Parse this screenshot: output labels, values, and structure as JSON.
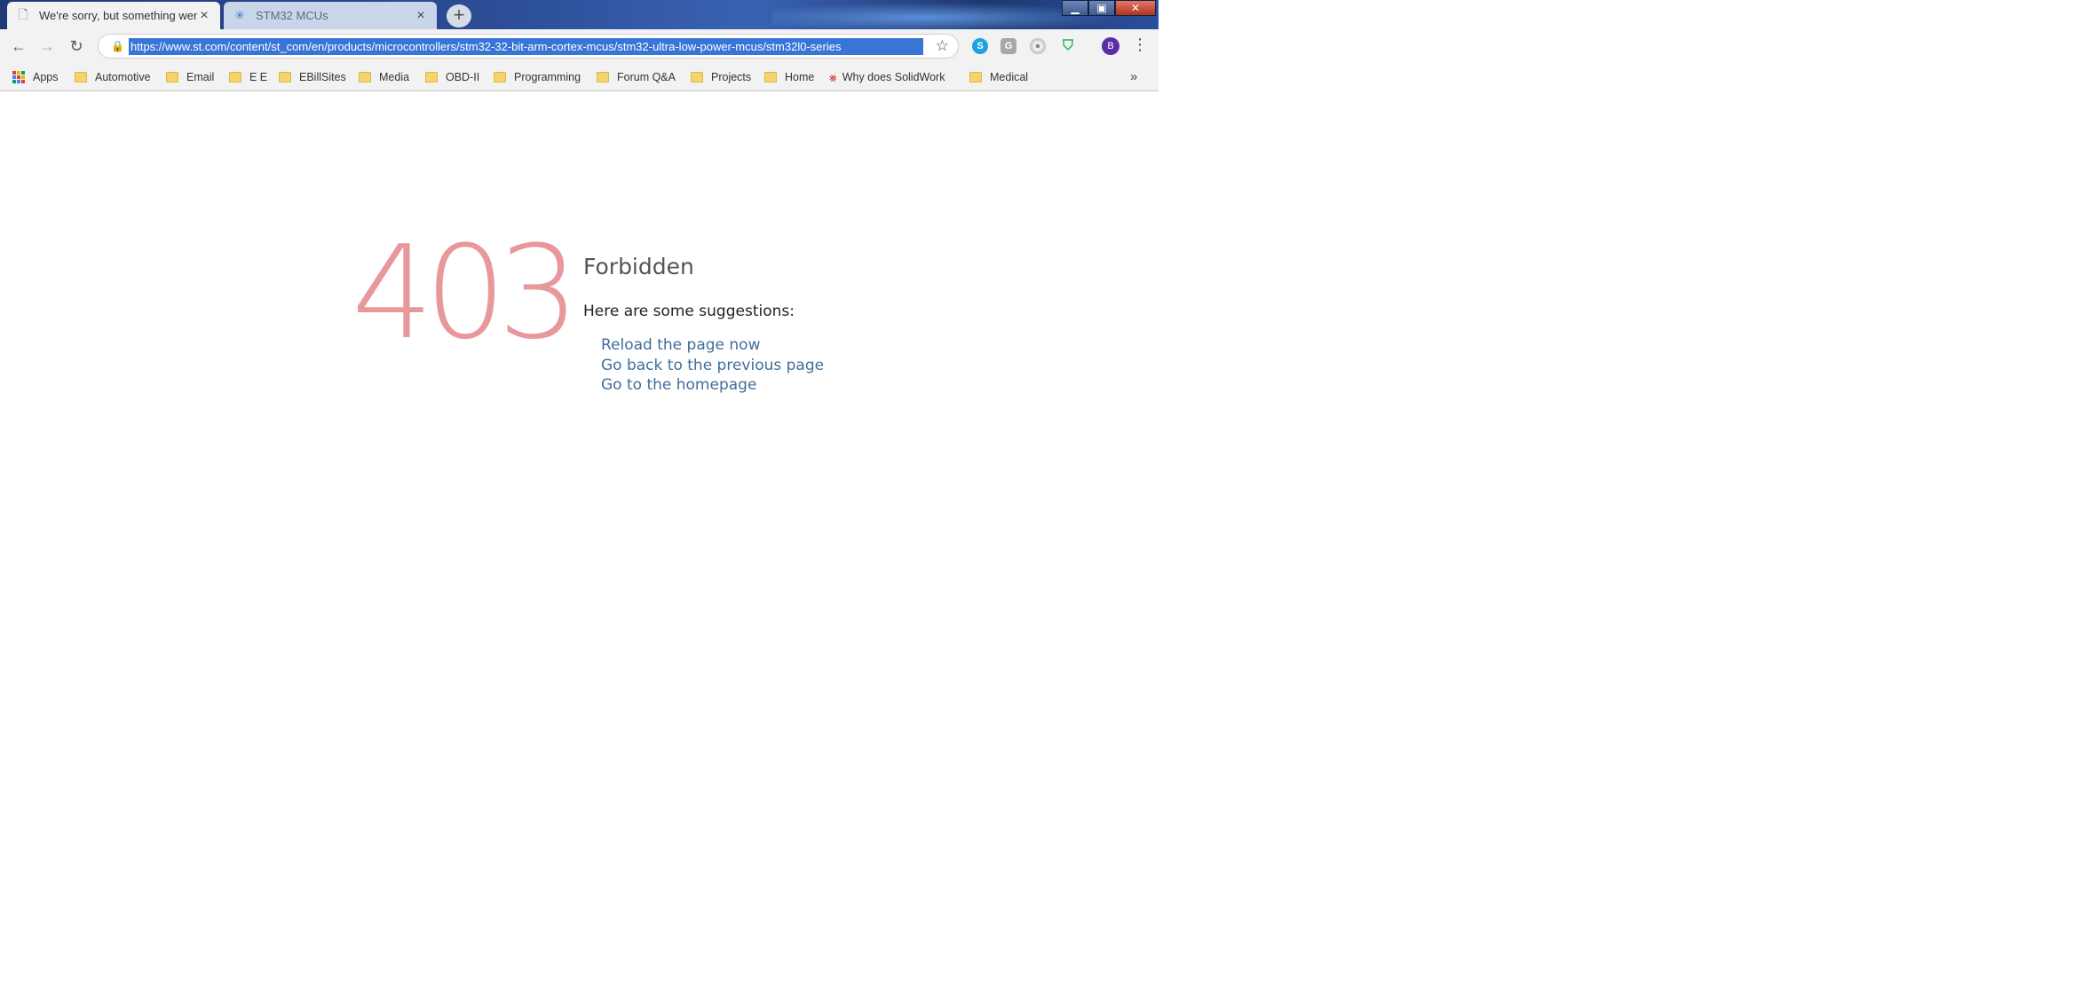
{
  "browser": {
    "tabs": [
      {
        "title": "We're sorry, but something went",
        "active": true,
        "favicon": "page-icon"
      },
      {
        "title": "STM32 MCUs",
        "active": false,
        "favicon": "st-logo-icon"
      }
    ],
    "new_tab_symbol": "+",
    "window_controls": {
      "minimize": "▁",
      "maximize": "▣",
      "close": "✕"
    },
    "url": "https://www.st.com/content/st_com/en/products/microcontrollers/stm32-32-bit-arm-cortex-mcus/stm32-ultra-low-power-mcus/stm32l0-series",
    "profile_initial": "B",
    "extensions": [
      "skype-icon",
      "gray-extension-icon",
      "circle-extension-icon",
      "shield-icon"
    ],
    "accent_color": "#3875d7"
  },
  "bookmarks": {
    "apps_label": "Apps",
    "items": [
      {
        "label": "Automotive"
      },
      {
        "label": "Email"
      },
      {
        "label": "E E"
      },
      {
        "label": "EBillSites"
      },
      {
        "label": "Media"
      },
      {
        "label": "OBD-II"
      },
      {
        "label": "Programming"
      },
      {
        "label": "Forum Q&A"
      },
      {
        "label": "Projects"
      },
      {
        "label": "Home"
      },
      {
        "label": "Why does SolidWork"
      },
      {
        "label": "Medical"
      }
    ],
    "overflow": "»"
  },
  "page": {
    "code": "403",
    "title": "Forbidden",
    "suggestions_label": "Here are some suggestions:",
    "links": [
      "Reload the page now",
      "Go back to the previous page",
      "Go to the homepage"
    ],
    "code_color": "#e8979b",
    "link_color": "#3f6e9b"
  }
}
